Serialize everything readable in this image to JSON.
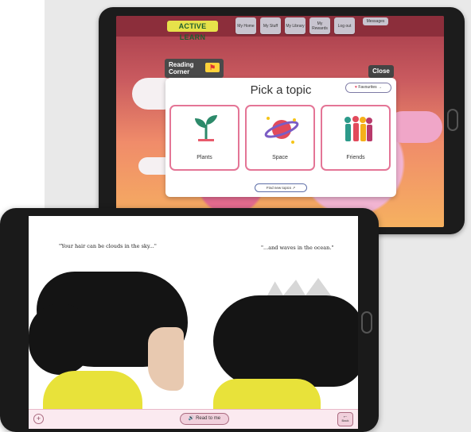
{
  "back_tablet": {
    "logo": "ACTIVE LEARN",
    "nav": [
      "My Home",
      "My Stuff",
      "My Library",
      "My Rewards",
      "Log out"
    ],
    "messages": "Messages",
    "reading_corner": "Reading Corner",
    "close": "Close",
    "modal": {
      "title": "Pick a topic",
      "favourites": "Favourites",
      "topics": [
        "Plants",
        "Space",
        "Friends"
      ],
      "find_new": "Find new topics"
    }
  },
  "front_tablet": {
    "quote_left": "\"Your hair can be clouds in the sky...\"",
    "quote_right": "\"...and waves in the ocean.\"",
    "read_to_me": "Read to me",
    "back": "Back",
    "plus": "+"
  },
  "colors": {
    "card_border": "#e47596",
    "topbar": "#8c2e3b",
    "logo_bg": "#e7e24a",
    "bottombar": "#fbeaf0"
  }
}
